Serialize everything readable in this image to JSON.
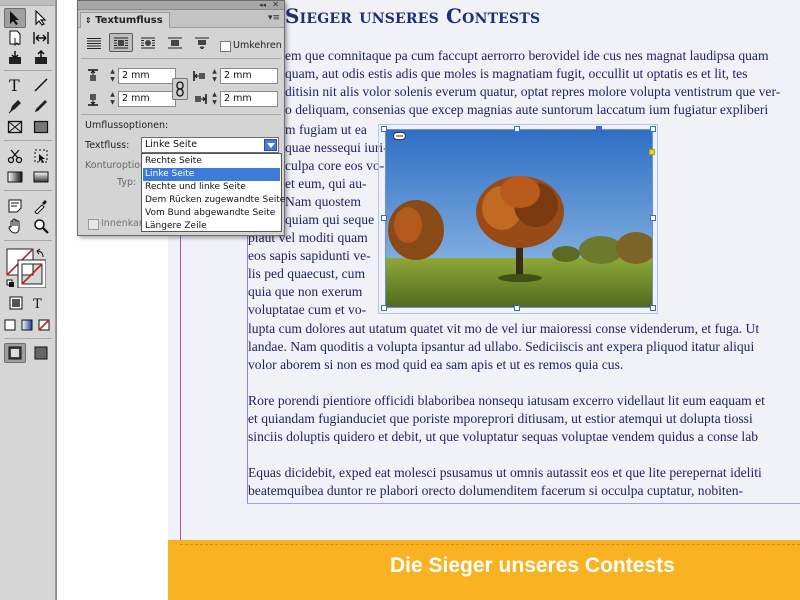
{
  "document": {
    "headline": "Sieger unseres Contests",
    "lines_top": [
      "em que comnitaque pa cum faccupt aerrorro berovidel ide cus nes magnat laudipsa quam",
      "quam, aut odis estis adis que moles is magnatiam fugit, occullit ut optatis es et lit, tes",
      "ditisin nit alis volor solenis everum quatur, optat repres molore volupta ventistrum que ver-",
      "o deliquam, consenias que excep magnias aute suntorum laccatum ium fugiatur expliberi"
    ],
    "lines_left": [
      "m fugiam ut ea",
      "quae nessequi iuri-",
      "culpa core eos vo-",
      "et eum, qui au-",
      "Nam quostem",
      "quiam qui seque",
      "plaut vel moditi quam",
      "eos sapis sapidunti ve-",
      "lis ped quaecust, cum",
      "quia que non exerum",
      "voluptatae cum et vo-"
    ],
    "lines_after": [
      "lupta cum dolores aut utatum quatet vit mo de vel iur maioressi conse videnderum, et fuga. Ut",
      "landae. Nam quoditis a volupta ipsantur ad ullabo. Sediciiscis ant expera pliquod itatur aliqui",
      "volor aborem si non es mod quid ea sam apis et ut es remos quia cus."
    ],
    "paragraph2": [
      "Rore porendi pientiore officidi blaboribea nonsequ iatusam excerro videllaut lit eum eaquam et",
      "et quiandam fugianduciet que poriste mporeprori ditiusam, ut estior atemqui ut dolupta tiossi",
      "sinciis doluptis quidero et debit, ut que voluptatur sequas voluptae vendem quidus a conse lab"
    ],
    "paragraph3": [
      "Equas dicidebit, exped eat molesci psusamus ut omnis autassit eos et que lite perepernat ideliti",
      "beatemquibea duntor re plabori orecto dolumenditem facerum si occulpa cuptatur, nobiten-"
    ],
    "footer": "Die Sieger unseres Contests"
  },
  "panel": {
    "title": "Textumfluss",
    "collapse": "◂◂",
    "close": "✕",
    "menu": "▾≡",
    "invert_label": "Umkehren",
    "top_offset": "2 mm",
    "bottom_offset": "2 mm",
    "left_offset": "2 mm",
    "right_offset": "2 mm",
    "options_header": "Umflussoptionen:",
    "textflow_label": "Textfluss:",
    "textflow_value": "Linke Seite",
    "contour_label": "Konturoptione",
    "type_label": "Typ:",
    "inside_label": "Innenkan",
    "dropdown": [
      "Rechte Seite",
      "Linke Seite",
      "Rechte und linke Seite",
      "Dem Rücken zugewandte Seite",
      "Vom Bund abgewandte Seite",
      "Längere Zeile"
    ],
    "dropdown_selected": 1
  },
  "colors": {
    "headline": "#1e2f73",
    "body_text": "#1e2363",
    "footer_bg": "#f9b322",
    "selection": "#3d7bdb"
  }
}
